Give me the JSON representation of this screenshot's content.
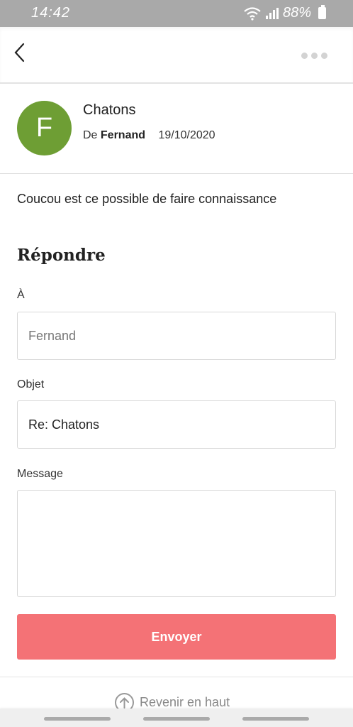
{
  "status_bar": {
    "time": "14:42",
    "battery": "88%"
  },
  "topbar": {
    "back_icon": "chevron-left-icon",
    "more_icon": "more-horizontal-icon"
  },
  "message": {
    "avatar_letter": "F",
    "avatar_color": "#6e9e34",
    "subject": "Chatons",
    "from_prefix": "De",
    "from_name": "Fernand",
    "date": "19/10/2020",
    "body": "Coucou est ce possible de faire connaissance"
  },
  "reply": {
    "title": "Répondre",
    "to_label": "À",
    "to_placeholder": "Fernand",
    "subject_label": "Objet",
    "subject_value": "Re: Chatons",
    "message_label": "Message",
    "message_value": "",
    "send_label": "Envoyer",
    "send_color": "#f47276"
  },
  "footer": {
    "back_to_top": "Revenir en haut",
    "icon": "arrow-up-circle-icon"
  }
}
